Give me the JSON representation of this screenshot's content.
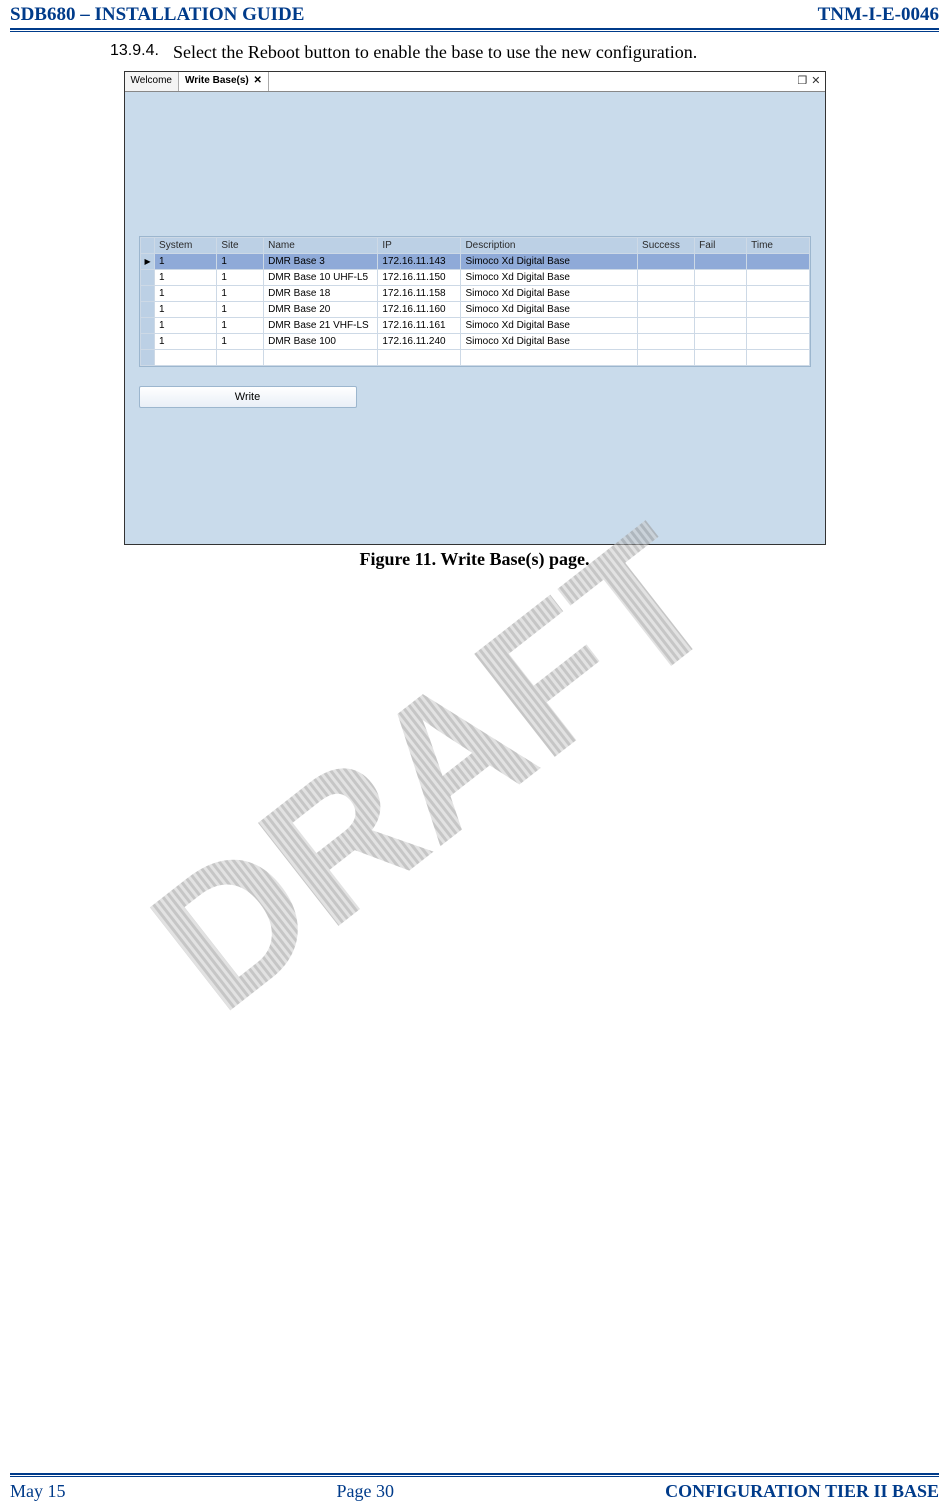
{
  "header": {
    "left": "SDB680 – INSTALLATION GUIDE",
    "right": "TNM-I-E-0046"
  },
  "step": {
    "num": "13.9.4.",
    "text": "Select the Reboot button to enable the base to use the new configuration."
  },
  "tabs": {
    "welcome": "Welcome",
    "active": "Write Base(s)"
  },
  "grid": {
    "headers": [
      "System",
      "Site",
      "Name",
      "IP",
      "Description",
      "Success",
      "Fail",
      "Time"
    ],
    "rows": [
      {
        "sys": "1",
        "site": "1",
        "name": "DMR Base 3",
        "ip": "172.16.11.143",
        "desc": "Simoco Xd Digital Base",
        "succ": "",
        "fail": "",
        "time": ""
      },
      {
        "sys": "1",
        "site": "1",
        "name": "DMR Base 10 UHF-L5",
        "ip": "172.16.11.150",
        "desc": "Simoco Xd Digital Base",
        "succ": "",
        "fail": "",
        "time": ""
      },
      {
        "sys": "1",
        "site": "1",
        "name": "DMR Base 18",
        "ip": "172.16.11.158",
        "desc": "Simoco Xd Digital Base",
        "succ": "",
        "fail": "",
        "time": ""
      },
      {
        "sys": "1",
        "site": "1",
        "name": "DMR Base 20",
        "ip": "172.16.11.160",
        "desc": "Simoco Xd Digital Base",
        "succ": "",
        "fail": "",
        "time": ""
      },
      {
        "sys": "1",
        "site": "1",
        "name": "DMR Base 21 VHF-LS",
        "ip": "172.16.11.161",
        "desc": "Simoco Xd Digital Base",
        "succ": "",
        "fail": "",
        "time": ""
      },
      {
        "sys": "1",
        "site": "1",
        "name": "DMR Base 100",
        "ip": "172.16.11.240",
        "desc": "Simoco Xd Digital Base",
        "succ": "",
        "fail": "",
        "time": ""
      }
    ]
  },
  "write_button": "Write",
  "caption": "Figure 11.  Write Base(s) page.",
  "watermark": "DRAFT",
  "footer": {
    "left": "May 15",
    "mid": "Page 30",
    "right": "CONFIGURATION TIER II BASE"
  }
}
